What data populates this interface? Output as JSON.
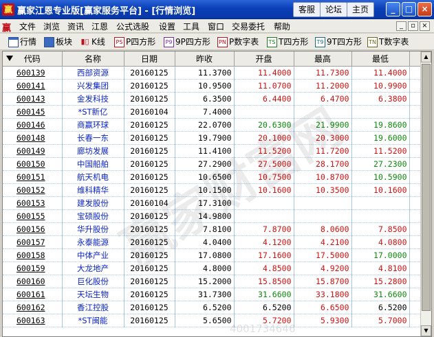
{
  "window": {
    "logo": "赢",
    "title": "赢家江恩专业版[赢家服务平台] - [行情浏览]",
    "buttons": [
      "客服",
      "论坛",
      "主页"
    ],
    "controls": [
      "_",
      "□",
      "×"
    ]
  },
  "menubar": {
    "logo": "赢",
    "items": [
      "文件",
      "浏览",
      "资讯",
      "江恩",
      "公式选股",
      "设置",
      "工具",
      "窗口",
      "交易委托",
      "帮助"
    ],
    "mdi_controls": [
      "_",
      "▫",
      "×"
    ]
  },
  "toolbar": {
    "items": [
      {
        "icon": "grid-icon",
        "glyph": "",
        "label": "行情"
      },
      {
        "icon": "blocks-icon",
        "glyph": "",
        "label": "板块"
      },
      {
        "icon": "kline-icon",
        "glyph": "▮▯",
        "label": "K线"
      },
      {
        "icon": "ps-icon",
        "glyph": "PS",
        "label": "P四方形"
      },
      {
        "icon": "p9-icon",
        "glyph": "P9",
        "label": "9P四方形"
      },
      {
        "icon": "pn-icon",
        "glyph": "PN",
        "label": "P数字表"
      },
      {
        "icon": "ts-icon",
        "glyph": "TS",
        "label": "T四方形"
      },
      {
        "icon": "t9-icon",
        "glyph": "T9",
        "label": "9T四方形"
      },
      {
        "icon": "tn-icon",
        "glyph": "TN",
        "label": "T数字表"
      }
    ]
  },
  "table": {
    "headers": [
      "代码",
      "名称",
      "日期",
      "昨收",
      "开盘",
      "最高",
      "最低"
    ],
    "rows": [
      {
        "code": "600139",
        "name": "西部资源",
        "date": "20160125",
        "prev": "11.3700",
        "open": "11.4000",
        "high": "11.7300",
        "low": "11.4000",
        "oc": "up",
        "hc": "up",
        "lc": "up"
      },
      {
        "code": "600141",
        "name": "兴发集团",
        "date": "20160125",
        "prev": "10.9500",
        "open": "11.0700",
        "high": "11.2000",
        "low": "10.9900",
        "oc": "up",
        "hc": "up",
        "lc": "up"
      },
      {
        "code": "600143",
        "name": "金发科技",
        "date": "20160125",
        "prev": "6.3500",
        "open": "6.4400",
        "high": "6.4700",
        "low": "6.3800",
        "oc": "up",
        "hc": "up",
        "lc": "up"
      },
      {
        "code": "600145",
        "name": "*ST新亿",
        "date": "20160104",
        "prev": "7.4000",
        "open": "",
        "high": "",
        "low": "",
        "oc": "flat",
        "hc": "flat",
        "lc": "flat"
      },
      {
        "code": "600146",
        "name": "商赢环球",
        "date": "20160125",
        "prev": "22.0700",
        "open": "20.6300",
        "high": "21.9900",
        "low": "19.8600",
        "oc": "down",
        "hc": "down",
        "lc": "down"
      },
      {
        "code": "600148",
        "name": "长春一东",
        "date": "20160125",
        "prev": "19.7900",
        "open": "20.1000",
        "high": "20.3000",
        "low": "19.6000",
        "oc": "up",
        "hc": "up",
        "lc": "down"
      },
      {
        "code": "600149",
        "name": "廊坊发展",
        "date": "20160125",
        "prev": "11.4100",
        "open": "11.5200",
        "high": "11.7200",
        "low": "11.5200",
        "oc": "up",
        "hc": "up",
        "lc": "up"
      },
      {
        "code": "600150",
        "name": "中国船舶",
        "date": "20160125",
        "prev": "27.2900",
        "open": "27.5000",
        "high": "28.1700",
        "low": "27.2300",
        "oc": "up",
        "hc": "up",
        "lc": "down"
      },
      {
        "code": "600151",
        "name": "航天机电",
        "date": "20160125",
        "prev": "10.6500",
        "open": "10.7500",
        "high": "10.8700",
        "low": "10.5900",
        "oc": "up",
        "hc": "up",
        "lc": "down"
      },
      {
        "code": "600152",
        "name": "维科精华",
        "date": "20160125",
        "prev": "10.1500",
        "open": "10.1600",
        "high": "10.3500",
        "low": "10.1600",
        "oc": "up",
        "hc": "up",
        "lc": "up"
      },
      {
        "code": "600153",
        "name": "建发股份",
        "date": "20160104",
        "prev": "17.3100",
        "open": "",
        "high": "",
        "low": "",
        "oc": "flat",
        "hc": "flat",
        "lc": "flat"
      },
      {
        "code": "600155",
        "name": "宝硕股份",
        "date": "20160125",
        "prev": "14.9800",
        "open": "",
        "high": "",
        "low": "",
        "oc": "flat",
        "hc": "flat",
        "lc": "flat"
      },
      {
        "code": "600156",
        "name": "华升股份",
        "date": "20160125",
        "prev": "7.8100",
        "open": "7.8700",
        "high": "8.0600",
        "low": "7.8500",
        "oc": "up",
        "hc": "up",
        "lc": "up"
      },
      {
        "code": "600157",
        "name": "永泰能源",
        "date": "20160125",
        "prev": "4.0400",
        "open": "4.1200",
        "high": "4.2100",
        "low": "4.0800",
        "oc": "up",
        "hc": "up",
        "lc": "up"
      },
      {
        "code": "600158",
        "name": "中体产业",
        "date": "20160125",
        "prev": "17.0800",
        "open": "17.1600",
        "high": "17.5000",
        "low": "17.0000",
        "oc": "up",
        "hc": "up",
        "lc": "down"
      },
      {
        "code": "600159",
        "name": "大龙地产",
        "date": "20160125",
        "prev": "4.8000",
        "open": "4.8500",
        "high": "4.9200",
        "low": "4.8100",
        "oc": "up",
        "hc": "up",
        "lc": "up"
      },
      {
        "code": "600160",
        "name": "巨化股份",
        "date": "20160125",
        "prev": "15.2000",
        "open": "15.8500",
        "high": "15.8700",
        "low": "15.2800",
        "oc": "up",
        "hc": "up",
        "lc": "up"
      },
      {
        "code": "600161",
        "name": "天坛生物",
        "date": "20160125",
        "prev": "31.7300",
        "open": "31.6600",
        "high": "33.1800",
        "low": "31.6600",
        "oc": "down",
        "hc": "up",
        "lc": "down"
      },
      {
        "code": "600162",
        "name": "香江控股",
        "date": "20160125",
        "prev": "6.5200",
        "open": "6.5200",
        "high": "6.6500",
        "low": "6.5200",
        "oc": "flat",
        "hc": "up",
        "lc": "flat"
      },
      {
        "code": "600163",
        "name": "*ST闽能",
        "date": "20160125",
        "prev": "5.6500",
        "open": "5.7200",
        "high": "5.9300",
        "low": "5.7000",
        "oc": "up",
        "hc": "up",
        "lc": "up"
      }
    ]
  },
  "colors": {
    "up": "#d01010",
    "down": "#0a8a0a",
    "name": "#0a24c8",
    "titlebar": "#0a3fb8"
  },
  "watermark": "赢家财富网",
  "watermark_url": "www.yingjia360.com",
  "watermark_phone": "4001734646"
}
